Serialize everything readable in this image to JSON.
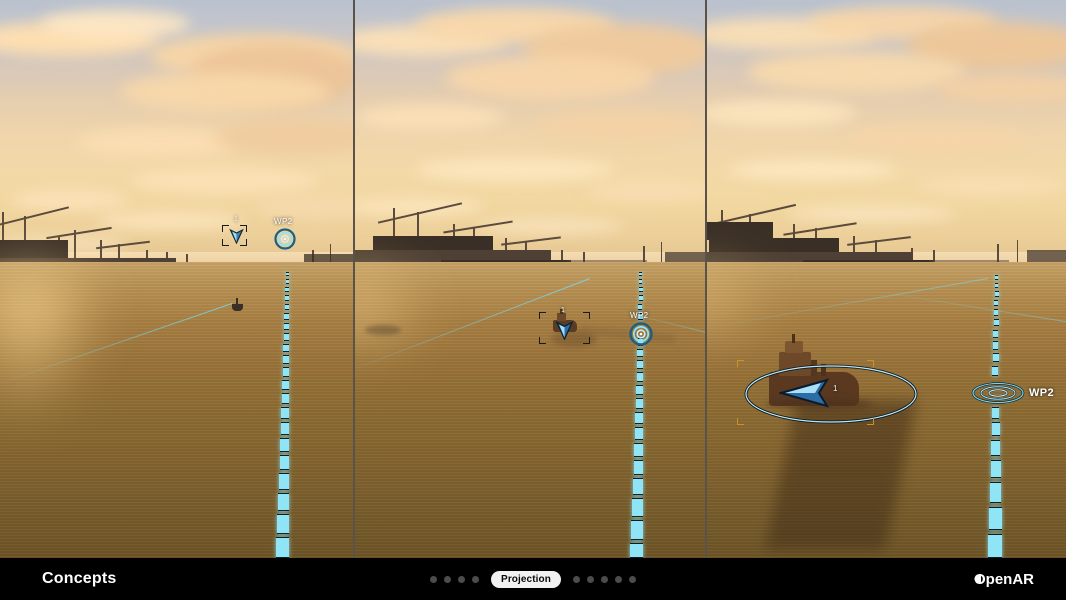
{
  "footer": {
    "left_label": "Concepts",
    "pager": {
      "dots_before": 4,
      "dots_after": 5,
      "current_label": "Projection"
    },
    "brand": "OpenAR",
    "brand_mark": "play-triangle-icon"
  },
  "panels": [
    {
      "id": "panel-far",
      "name": "projection-view-far",
      "waypoint": {
        "label": "WP2",
        "marker": "waypoint-target-icon"
      },
      "vessel": {
        "label": "1",
        "marker": "vessel-arrow-icon",
        "selected": true
      },
      "route": {
        "name": "ar-route-line",
        "color": "#8fe4f5"
      }
    },
    {
      "id": "panel-mid",
      "name": "projection-view-mid",
      "waypoint": {
        "label": "WP2",
        "marker": "waypoint-target-icon"
      },
      "vessel": {
        "label": "1",
        "marker": "vessel-arrow-icon",
        "selected": true
      },
      "route": {
        "name": "ar-route-line",
        "color": "#8fe4f5"
      }
    },
    {
      "id": "panel-near",
      "name": "projection-view-near",
      "waypoint": {
        "label": "WP2",
        "marker": "waypoint-ring-icon"
      },
      "vessel": {
        "label": "1",
        "marker": "vessel-arrow-icon",
        "selected": true
      },
      "route": {
        "name": "ar-route-line",
        "color": "#8fe4f5"
      }
    }
  ],
  "colors": {
    "ar_cyan": "#8fe4f5",
    "ar_cyan_dark": "#2a93ad",
    "water": "#8e6c33",
    "sky_warm": "#f2d7a0",
    "footer_bg": "#000000",
    "pill_bg": "#f2f2f2"
  }
}
